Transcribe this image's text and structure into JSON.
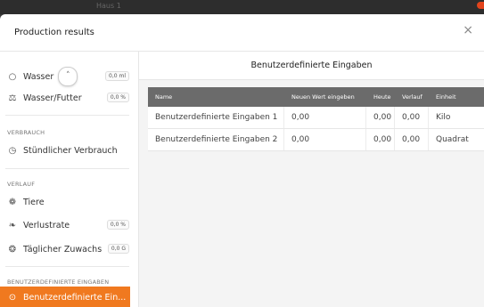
{
  "window": {
    "ghost_title": "Haus 1"
  },
  "modal": {
    "title": "Production results",
    "close_symbol": "×"
  },
  "sidebar": {
    "items_top": [
      {
        "label": "Wasser",
        "badge": "0,0 ml",
        "icon": "water-drop-icon",
        "glyph": "○"
      },
      {
        "label": "Wasser/Futter",
        "badge": "0,0 %",
        "icon": "scale-icon",
        "glyph": "⚖"
      }
    ],
    "collapse_glyph": "˄",
    "sections": {
      "verbrauch": "VERBRAUCH",
      "verlauf": "VERLAUF",
      "benutzerdefiniert": "BENUTZERDEFINIERTE EINGABEN"
    },
    "verbrauch_items": [
      {
        "label": "Stündlicher Verbrauch",
        "icon": "clock-icon",
        "glyph": "◷"
      }
    ],
    "verlauf_items": [
      {
        "label": "Tiere",
        "icon": "bird-icon",
        "glyph": "❁",
        "badge": ""
      },
      {
        "label": "Verlustrate",
        "icon": "feather-icon",
        "glyph": "❧",
        "badge": "0,0 %"
      },
      {
        "label": "Täglicher Zuwachs",
        "icon": "growth-icon",
        "glyph": "❂",
        "badge": "0,0 G"
      }
    ],
    "active_item": {
      "label": "Benutzerdefinierte Ein...",
      "icon": "custom-input-icon",
      "glyph": "⊙"
    }
  },
  "main": {
    "heading": "Benutzerdefinierte Eingaben",
    "table": {
      "headers": [
        "Name",
        "Neuen Wert eingeben",
        "Heute",
        "Verlauf",
        "Einheit"
      ],
      "rows": [
        [
          "Benutzerdefinierte Eingaben 1",
          "0,00",
          "0,00",
          "0,00",
          "Kilo"
        ],
        [
          "Benutzerdefinierte Eingaben 2",
          "0,00",
          "0,00",
          "0,00",
          "Quadrat"
        ]
      ]
    }
  },
  "colors": {
    "accent": "#f0791f",
    "header_bg": "#6b6b6b",
    "close_dot": "#e2441c"
  }
}
